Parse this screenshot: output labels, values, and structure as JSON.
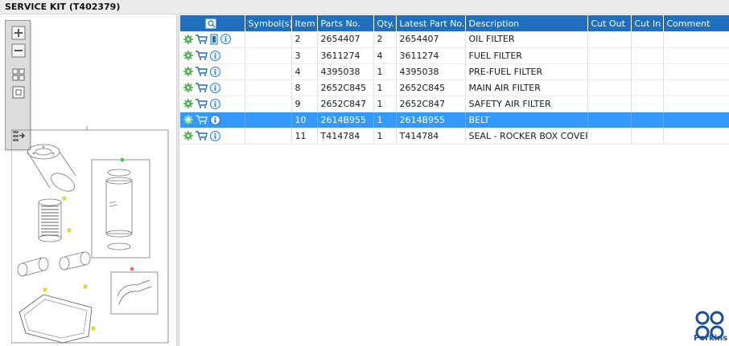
{
  "window": {
    "title": "SERVICE KIT (T402379)"
  },
  "toolbar": {
    "buttons": [
      {
        "name": "zoom-in-icon"
      },
      {
        "name": "zoom-out-icon"
      },
      {
        "name": "fit-grid-icon"
      },
      {
        "name": "fit-window-icon"
      },
      {
        "name": "export-icon"
      }
    ]
  },
  "grid": {
    "columns": [
      "",
      "Symbol(s)",
      "Item",
      "Parts No.",
      "Qty.",
      "Latest Part No.",
      "Description",
      "Cut Out",
      "Cut In",
      "Comment"
    ],
    "rows": [
      {
        "item": "2",
        "parts_no": "2654407",
        "qty": "2",
        "latest_part_no": "2654407",
        "description": "OIL FILTER",
        "cut_out": "",
        "cut_in": "",
        "comment": "",
        "symbols": "",
        "has_doc": true
      },
      {
        "item": "3",
        "parts_no": "3611274",
        "qty": "4",
        "latest_part_no": "3611274",
        "description": "FUEL FILTER",
        "cut_out": "",
        "cut_in": "",
        "comment": "",
        "symbols": "",
        "has_doc": false
      },
      {
        "item": "4",
        "parts_no": "4395038",
        "qty": "1",
        "latest_part_no": "4395038",
        "description": "PRE-FUEL FILTER",
        "cut_out": "",
        "cut_in": "",
        "comment": "",
        "symbols": "",
        "has_doc": false
      },
      {
        "item": "8",
        "parts_no": "2652C845",
        "qty": "1",
        "latest_part_no": "2652C845",
        "description": "MAIN AIR FILTER",
        "cut_out": "",
        "cut_in": "",
        "comment": "",
        "symbols": "",
        "has_doc": false
      },
      {
        "item": "9",
        "parts_no": "2652C847",
        "qty": "1",
        "latest_part_no": "2652C847",
        "description": "SAFETY AIR FILTER",
        "cut_out": "",
        "cut_in": "",
        "comment": "",
        "symbols": "",
        "has_doc": false
      },
      {
        "item": "10",
        "parts_no": "2614B955",
        "qty": "1",
        "latest_part_no": "2614B955",
        "description": "BELT",
        "cut_out": "",
        "cut_in": "",
        "comment": "",
        "symbols": "",
        "has_doc": false,
        "selected": true
      },
      {
        "item": "11",
        "parts_no": "T414784",
        "qty": "1",
        "latest_part_no": "T414784",
        "description": "SEAL - ROCKER BOX COVER",
        "cut_out": "",
        "cut_in": "",
        "comment": "",
        "symbols": "",
        "has_doc": false
      }
    ]
  },
  "colors": {
    "header_bg": "#1f6fbf",
    "selected_bg": "#3399ff",
    "gear": "#4caf50",
    "cart": "#1f6fbf",
    "info": "#2a7fd4",
    "logo": "#1b4f9c"
  },
  "logo": {
    "text": "Perkins"
  }
}
